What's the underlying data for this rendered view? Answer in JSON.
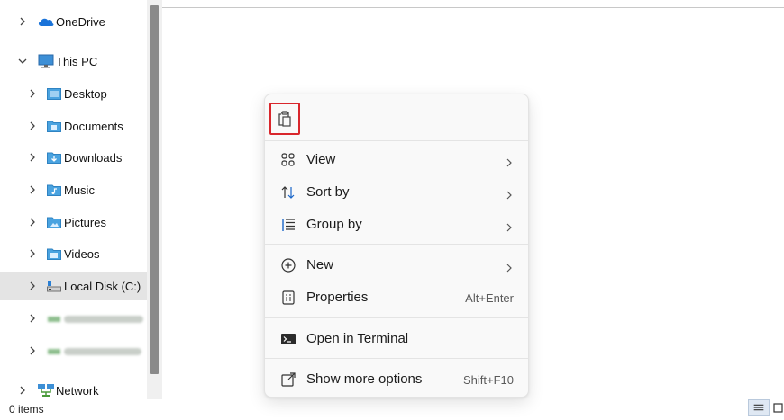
{
  "nav": {
    "items": [
      {
        "label": "OneDrive",
        "icon": "onedrive-cloud-icon",
        "expanded": false
      },
      {
        "label": "This PC",
        "icon": "computer-icon",
        "expanded": true
      },
      {
        "label": "Desktop",
        "icon": "desktop-folder-icon",
        "expanded": false
      },
      {
        "label": "Documents",
        "icon": "documents-folder-icon",
        "expanded": false
      },
      {
        "label": "Downloads",
        "icon": "downloads-folder-icon",
        "expanded": false
      },
      {
        "label": "Music",
        "icon": "music-folder-icon",
        "expanded": false
      },
      {
        "label": "Pictures",
        "icon": "pictures-folder-icon",
        "expanded": false
      },
      {
        "label": "Videos",
        "icon": "videos-folder-icon",
        "expanded": false
      },
      {
        "label": "Local Disk (C:)",
        "icon": "drive-icon",
        "expanded": false,
        "selected": true
      },
      {
        "label": "",
        "icon": "network-drive-icon",
        "expanded": false,
        "redacted": true
      },
      {
        "label": "",
        "icon": "network-drive-icon",
        "expanded": false,
        "redacted": true
      },
      {
        "label": "Network",
        "icon": "network-icon",
        "expanded": false
      }
    ]
  },
  "status": {
    "items_text": "0 items"
  },
  "context_menu": {
    "paste_icon": "paste-clipboard-icon",
    "items": [
      {
        "label": "View",
        "icon": "view-grid-icon",
        "has_submenu": true
      },
      {
        "label": "Sort by",
        "icon": "sort-icon",
        "has_submenu": true
      },
      {
        "label": "Group by",
        "icon": "group-by-icon",
        "has_submenu": true
      },
      {
        "label": "New",
        "icon": "new-plus-icon",
        "has_submenu": true
      },
      {
        "label": "Properties",
        "icon": "properties-icon",
        "shortcut": "Alt+Enter"
      },
      {
        "label": "Open in Terminal",
        "icon": "terminal-icon"
      },
      {
        "label": "Show more options",
        "icon": "more-options-icon",
        "shortcut": "Shift+F10"
      }
    ]
  },
  "colors": {
    "highlight_border": "#d9262c",
    "selected_row": "#e4e4e4",
    "folder_blue": "#4aa3e0"
  }
}
